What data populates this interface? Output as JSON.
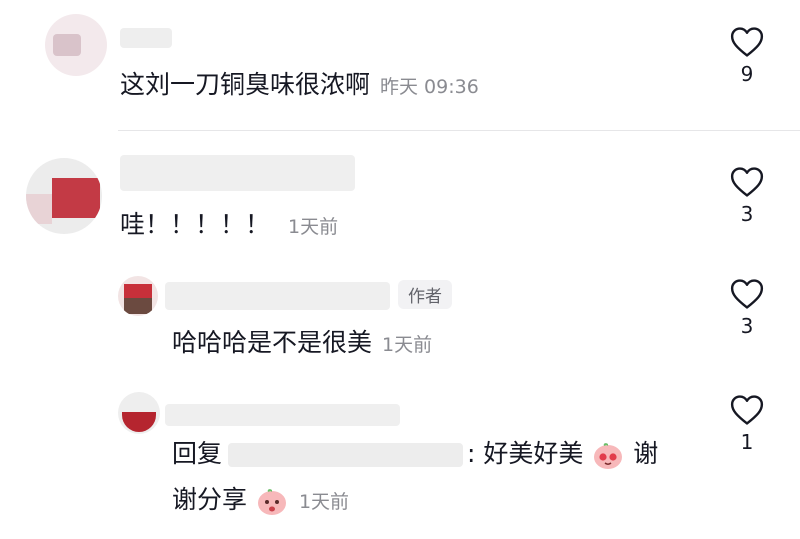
{
  "comments": [
    {
      "user": "",
      "text": "这刘一刀铜臭味很浓啊",
      "time": "昨天 09:36",
      "likes": "9"
    },
    {
      "user": "",
      "text": "哇！！！！！",
      "time": "1天前",
      "likes": "3"
    },
    {
      "user": "",
      "author_tag": "作者",
      "text": "哈哈哈是不是很美",
      "time": "1天前",
      "likes": "3"
    },
    {
      "user": "",
      "reply_prefix": "回复",
      "reply_target": "",
      "text_part1": ": 好美好美",
      "text_part2": " 谢",
      "text_line2": "谢分享",
      "time": "1天前",
      "likes": "1"
    }
  ],
  "icons": {
    "like": "heart-outline-icon",
    "emoji": "peach-face-emoji"
  },
  "colors": {
    "text": "#161823",
    "secondary": "#8a8b91",
    "divider": "#e6e6e8"
  }
}
